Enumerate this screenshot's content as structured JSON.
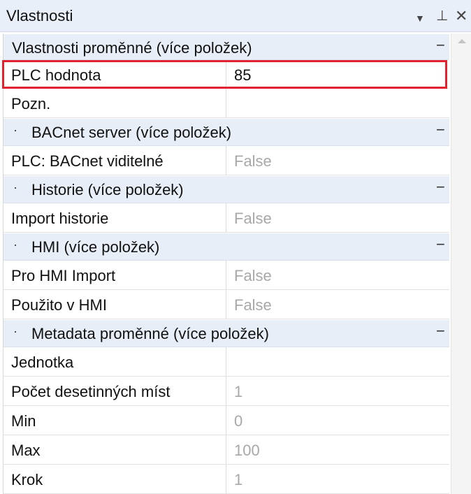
{
  "panel": {
    "title": "Vlastnosti",
    "icons": {
      "dropdown": "▼",
      "pin": "⊥",
      "close": "✕"
    }
  },
  "sections": [
    {
      "label": "Vlastnosti proměnné (více položek)",
      "toggle": "−",
      "rows": [
        {
          "name": "PLC hodnota",
          "value": "85"
        },
        {
          "name": "Pozn.",
          "value": ""
        }
      ]
    },
    {
      "label": "BACnet server (více položek)",
      "toggle": "−",
      "rows": [
        {
          "name": "PLC: BACnet viditelné",
          "value": "False"
        }
      ]
    },
    {
      "label": "Historie (více položek)",
      "toggle": "−",
      "rows": [
        {
          "name": "Import historie",
          "value": "False"
        }
      ]
    },
    {
      "label": "HMI (více položek)",
      "toggle": "−",
      "rows": [
        {
          "name": "Pro HMI Import",
          "value": "False"
        },
        {
          "name": "Použito v HMI",
          "value": "False"
        }
      ]
    },
    {
      "label": "Metadata proměnné (více položek)",
      "toggle": "−",
      "rows": [
        {
          "name": "Jednotka",
          "value": ""
        },
        {
          "name": "Počet desetinných míst",
          "value": "1"
        },
        {
          "name": "Min",
          "value": "0"
        },
        {
          "name": "Max",
          "value": "100"
        },
        {
          "name": "Krok",
          "value": "1"
        }
      ]
    }
  ],
  "colors": {
    "highlight": "#e0232e",
    "category_bg": "#e8eef7",
    "disabled_value": "#a8a8a8"
  }
}
